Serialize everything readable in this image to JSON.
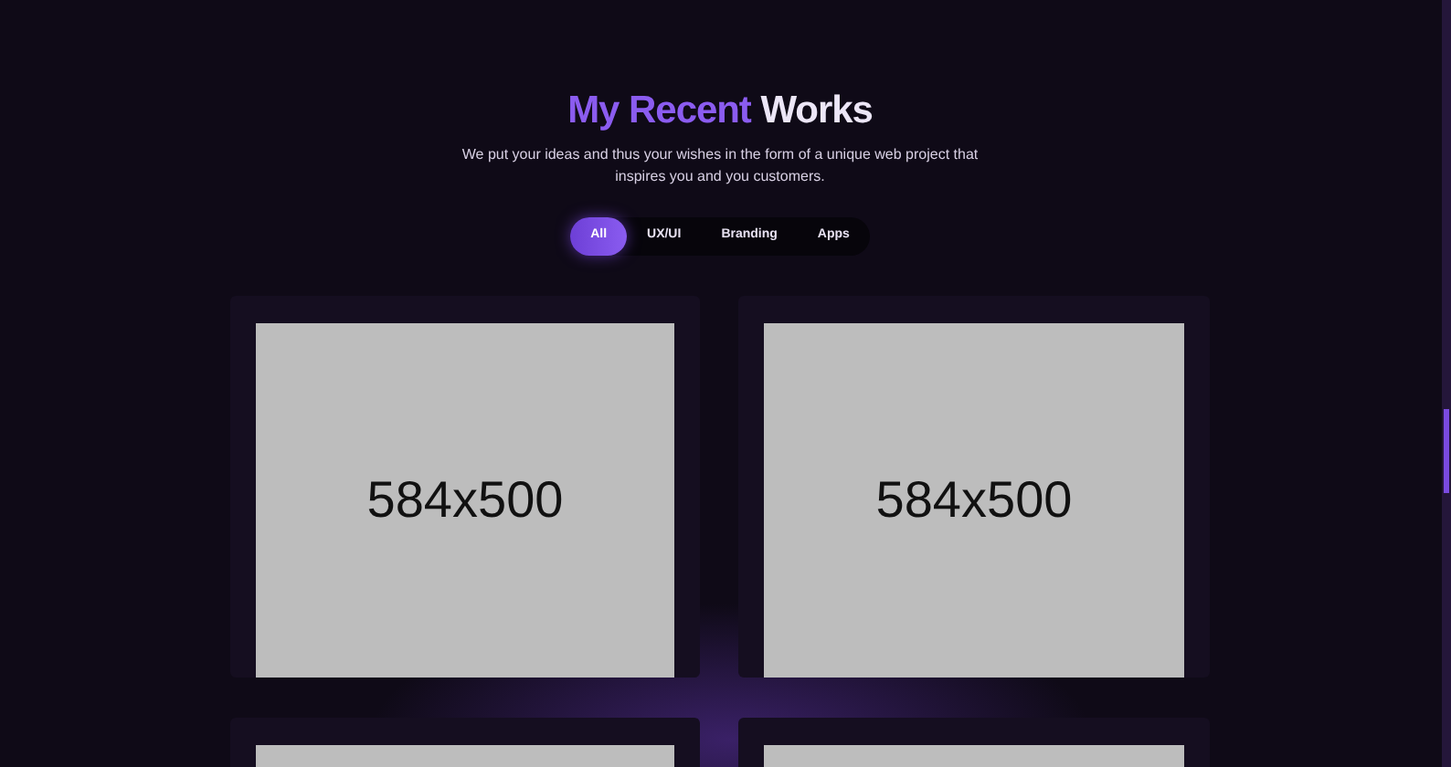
{
  "heading": {
    "accent": "My Recent",
    "rest": "Works"
  },
  "subtitle": "We put your ideas and thus your wishes in the form of a unique web project that inspires you and you customers.",
  "filters": [
    {
      "label": "All",
      "selected": true
    },
    {
      "label": "UX/UI",
      "selected": false
    },
    {
      "label": "Branding",
      "selected": false
    },
    {
      "label": "Apps",
      "selected": false
    }
  ],
  "works": [
    {
      "kind": "placeholder",
      "label": "584x500"
    },
    {
      "kind": "placeholder",
      "label": "584x500"
    },
    {
      "kind": "placeholder"
    },
    {
      "kind": "placeholder"
    }
  ]
}
